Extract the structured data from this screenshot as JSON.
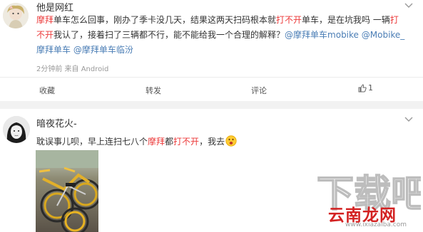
{
  "post1": {
    "username": "他是网红",
    "text": {
      "p1": "摩拜",
      "p2": "单车怎么回事，刚办了季卡没几天，结果这两天扫码根本就",
      "p3": "打不开",
      "p4": "单车，是在坑我吗 一辆",
      "p5": "打",
      "p6": "不开",
      "p7": "我认了，接着扫了三辆都不行，能不能给我一个合理的解释？",
      "p8": "@摩拜单车mobike",
      "p9": " ",
      "p10": "@Mobike_",
      "p11": "摩拜单车",
      "p12": " ",
      "p13": "@摩拜单车临汾"
    },
    "meta": "2分钟前 来自 Android",
    "actions": {
      "collect": "收藏",
      "repost": "转发",
      "comment": "评论",
      "like_count": "1"
    }
  },
  "post2": {
    "username": "暗夜花火-",
    "text": {
      "p1": "耽误事儿呗，早上连扫七八个",
      "p2": "摩拜",
      "p3": "都",
      "p4": "打不开",
      "p5": "，我去"
    }
  },
  "watermark": {
    "site_cn": "云南龙网",
    "site_url": "www.ixiazaiba.com",
    "logo_text": "下载吧"
  },
  "icons": {
    "expand": "chevron-down-icon",
    "like": "thumbs-up-icon",
    "emoji": "shocked-face-icon"
  },
  "colors": {
    "highlight": "#ec3b3b",
    "link": "#4a7db5",
    "meta": "#999999",
    "watermark_red": "#d32222"
  }
}
